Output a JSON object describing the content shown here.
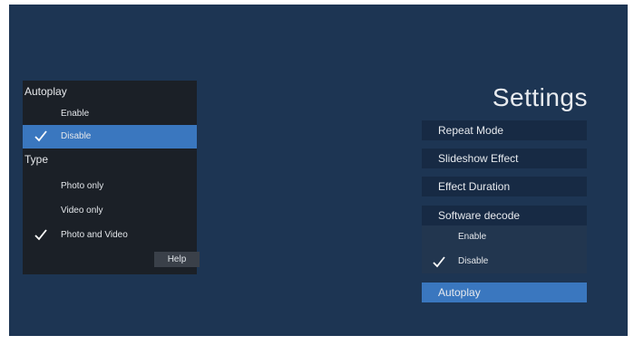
{
  "popup": {
    "autoplay_heading": "Autoplay",
    "autoplay_options": [
      {
        "label": "Enable",
        "selected": false
      },
      {
        "label": "Disable",
        "selected": true
      }
    ],
    "type_heading": "Type",
    "type_options": [
      {
        "label": "Photo only",
        "checked": false
      },
      {
        "label": "Video only",
        "checked": false
      },
      {
        "label": "Photo and Video",
        "checked": true
      }
    ],
    "help_label": "Help"
  },
  "settings": {
    "title": "Settings",
    "items": [
      {
        "label": "Repeat Mode"
      },
      {
        "label": "Slideshow Effect"
      },
      {
        "label": "Effect Duration"
      },
      {
        "label": "Software decode"
      },
      {
        "label": "Autoplay",
        "active": true
      }
    ],
    "software_decode_options": [
      {
        "label": "Enable",
        "checked": false
      },
      {
        "label": "Disable",
        "checked": true
      }
    ]
  },
  "colors": {
    "background": "#1d3553",
    "panel": "#1b2027",
    "highlight": "#3a77bf",
    "menu_item": "#172a44"
  },
  "icons": {
    "check": "check-icon"
  }
}
